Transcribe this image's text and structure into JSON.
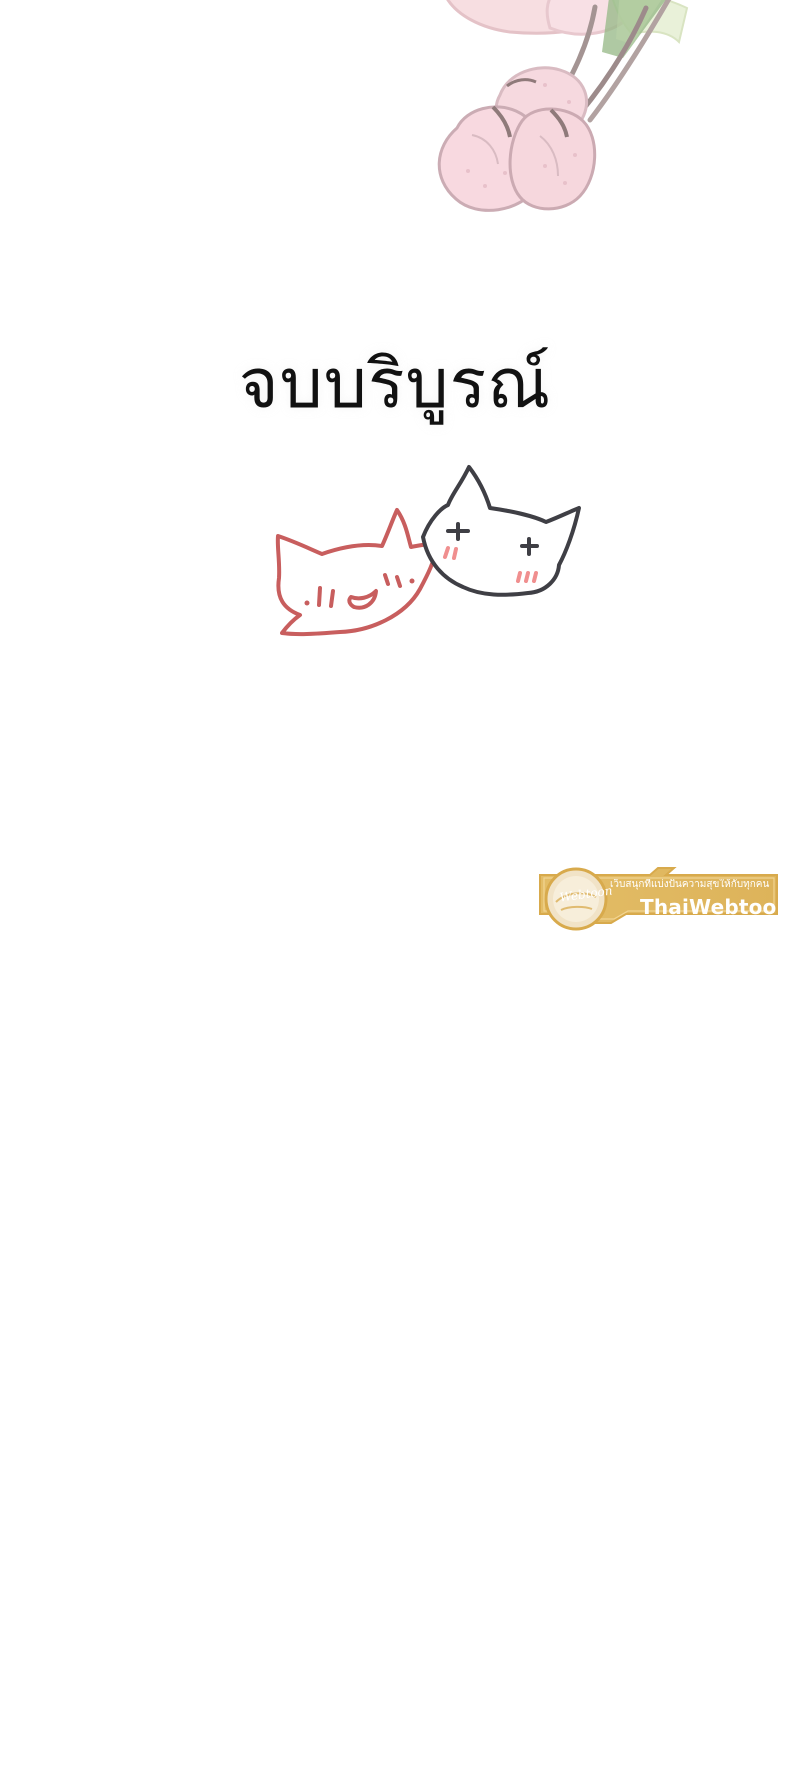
{
  "page": {
    "ending_text": "จบบริบูรณ์"
  },
  "decorations": {
    "flowers_icon": "cherry-blossom-branch-icon",
    "red_cat_icon": "red-cat-face-icon",
    "gray_cat_icon": "gray-cat-face-icon"
  },
  "watermark": {
    "tagline": "เว็บสนุกที่แบ่งปันความสุขให้กับทุกคน",
    "brand": "ThaiWebtoon",
    "logo_text": "Webtoon",
    "colors": {
      "band": "#e3bd67",
      "band_border": "#d8aa4c",
      "logo_fill": "#f4e6c7"
    }
  }
}
